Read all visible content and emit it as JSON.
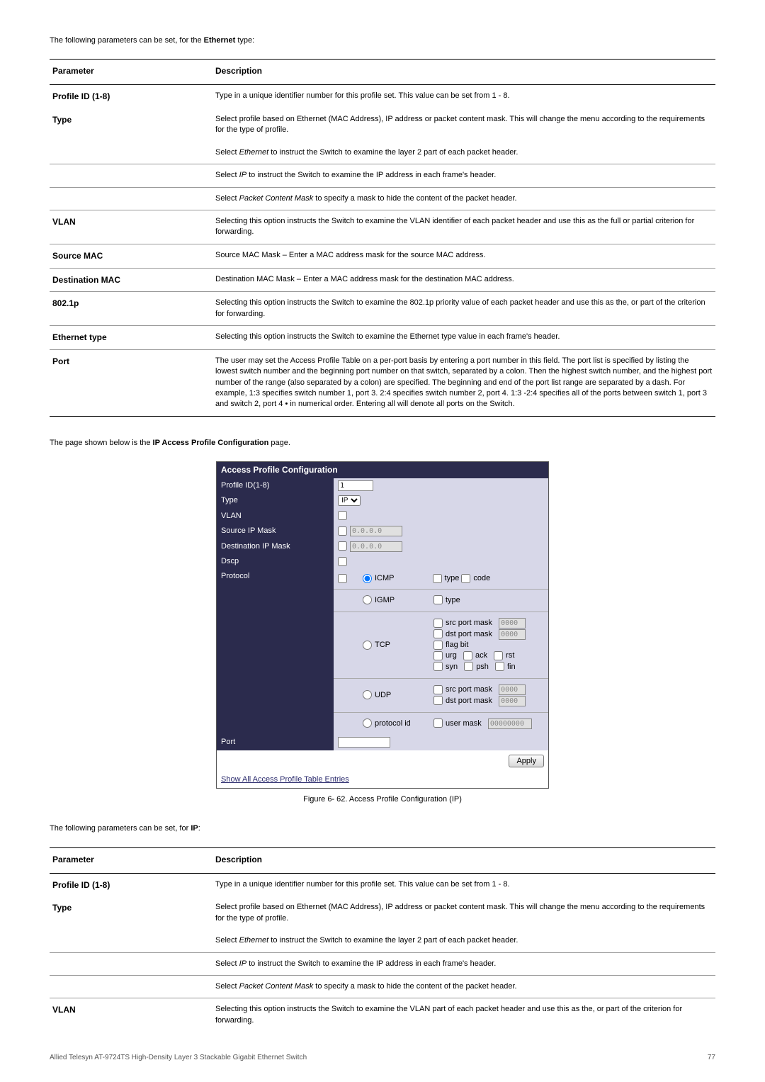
{
  "intro1": {
    "prefix": "The following parameters can be set, for the ",
    "bold": "Ethernet",
    "suffix": " type:"
  },
  "table1": {
    "head": {
      "param": "Parameter",
      "desc": "Description"
    },
    "rows": [
      {
        "name": "Profile ID (1-8)",
        "desc": "Type in a unique identifier number for this profile set. This value can be set from 1 - 8."
      },
      {
        "name": "Type",
        "desc": "Select profile based on Ethernet (MAC Address), IP address or packet content mask. This will change the menu according to the requirements for the type of profile."
      },
      {
        "name": "",
        "desc_pre": "Select ",
        "desc_italic": "Ethernet",
        "desc_post": " to instruct the Switch to examine the layer 2 part of each packet header."
      },
      {
        "name": "",
        "desc_pre": "Select ",
        "desc_italic": "IP",
        "desc_post": " to instruct the Switch to examine the IP address in each frame's header."
      },
      {
        "name": "",
        "desc_pre": "Select ",
        "desc_italic": "Packet Content Mask",
        "desc_post": " to specify a mask to hide the content of the packet header."
      },
      {
        "name": "VLAN",
        "desc": "Selecting this option instructs the Switch to examine the VLAN identifier of each packet header and use this as the full or partial criterion for forwarding."
      },
      {
        "name": "Source MAC",
        "desc": "Source MAC Mask – Enter a MAC address mask for the source MAC address."
      },
      {
        "name": "Destination MAC",
        "desc": "Destination MAC Mask – Enter a MAC address mask for the destination MAC address."
      },
      {
        "name": "802.1p",
        "desc": "Selecting this option instructs the Switch to examine the 802.1p priority value of each packet header and use this as the, or part of the criterion for forwarding."
      },
      {
        "name": "Ethernet type",
        "desc": "Selecting this option instructs the Switch to examine the Ethernet type value in each frame's header."
      },
      {
        "name": "Port",
        "desc": "The user may set the Access Profile Table on a per-port basis by entering a port number in this field. The port list is specified by listing the lowest switch number and the beginning port number on that switch, separated by a colon. Then the highest switch number, and the highest port number of the range (also separated by a colon) are specified. The beginning and end of the port list range are separated by a dash. For example, 1:3 specifies switch number 1, port 3. 2:4 specifies switch number 2, port 4. 1:3 -2:4 specifies all of the ports between switch 1, port 3 and switch 2, port 4 • in numerical order. Entering all will denote all ports on the Switch."
      }
    ]
  },
  "mid": {
    "prefix": "The page shown below is the ",
    "bold": "IP Access Profile Configuration",
    "suffix": " page."
  },
  "apc": {
    "title": "Access Profile Configuration",
    "labels": {
      "profile_id": "Profile ID(1-8)",
      "type": "Type",
      "vlan": "VLAN",
      "src_ip": "Source IP Mask",
      "dst_ip": "Destination IP Mask",
      "dscp": "Dscp",
      "protocol": "Protocol",
      "port": "Port"
    },
    "values": {
      "profile_id": "1",
      "type": "IP",
      "src_ip": "0.0.0.0",
      "dst_ip": "0.0.0.0"
    },
    "proto": {
      "icmp": {
        "label": "ICMP",
        "type": "type",
        "code": "code"
      },
      "igmp": {
        "label": "IGMP",
        "type": "type"
      },
      "tcp": {
        "label": "TCP",
        "src": "src port mask",
        "srcv": "0000",
        "dst": "dst port mask",
        "dstv": "0000",
        "flag": "flag bit",
        "urg": "urg",
        "ack": "ack",
        "rst": "rst",
        "syn": "syn",
        "psh": "psh",
        "fin": "fin"
      },
      "udp": {
        "label": "UDP",
        "src": "src port mask",
        "srcv": "0000",
        "dst": "dst port mask",
        "dstv": "0000"
      },
      "pid": {
        "label": "protocol id",
        "user": "user mask",
        "userv": "00000000"
      }
    },
    "apply": "Apply",
    "show": "Show All Access Profile Table Entries"
  },
  "figcap": "Figure 6- 62. Access Profile Configuration (IP)",
  "intro2": {
    "prefix": "The following parameters can be set, for ",
    "bold": "IP",
    "suffix": ":"
  },
  "table2": {
    "head": {
      "param": "Parameter",
      "desc": "Description"
    },
    "rows": [
      {
        "name": "Profile ID (1-8)",
        "desc": "Type in a unique identifier number for this profile set. This value can be set from 1 - 8."
      },
      {
        "name": "Type",
        "desc": "Select profile based on Ethernet (MAC Address), IP address or packet content mask. This will change the menu according to the requirements for the type of profile."
      },
      {
        "name": "",
        "desc_pre": "Select ",
        "desc_italic": "Ethernet",
        "desc_post": " to instruct the Switch to examine the layer 2 part of each packet header."
      },
      {
        "name": "",
        "desc_pre": "Select ",
        "desc_italic": "IP",
        "desc_post": " to instruct the Switch to examine the IP address in each frame's header."
      },
      {
        "name": "",
        "desc_pre": "Select ",
        "desc_italic": "Packet Content Mask",
        "desc_post": " to specify a mask to hide the content of the packet header."
      },
      {
        "name": "VLAN",
        "desc": "Selecting this option instructs the Switch to examine the VLAN part of each packet header and use this as the, or part of the criterion for forwarding."
      }
    ]
  },
  "footer": {
    "left": "Allied Telesyn AT-9724TS High-Density Layer 3 Stackable Gigabit Ethernet Switch",
    "right": "77"
  }
}
